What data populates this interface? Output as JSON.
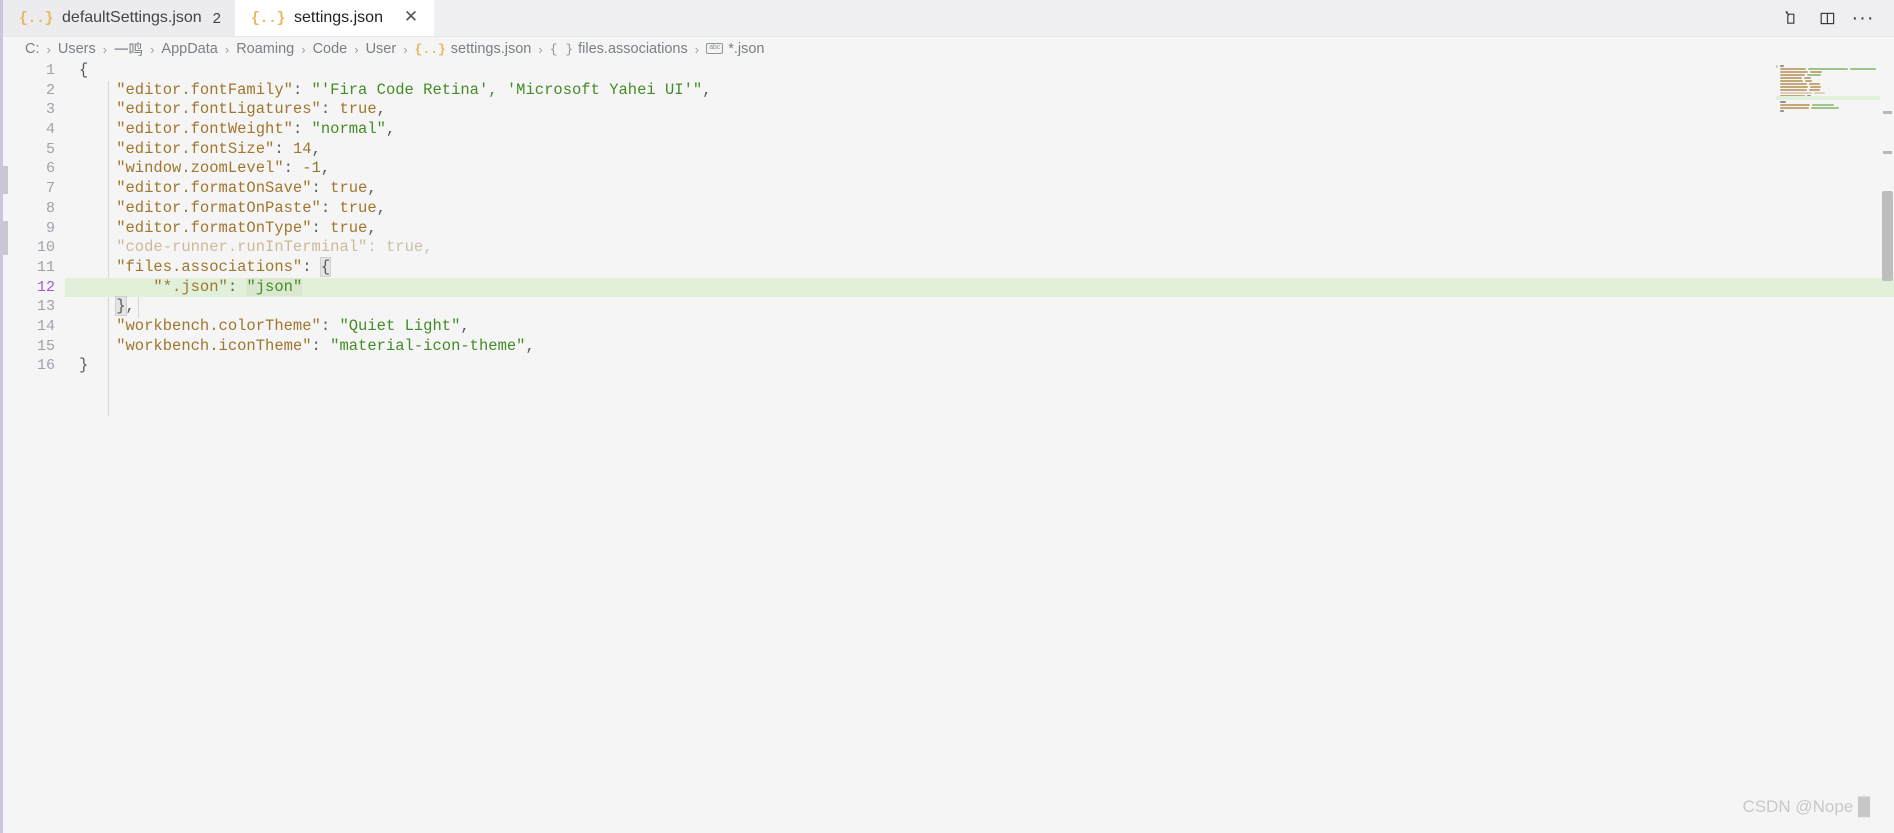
{
  "window": {
    "theme_name": "Quiet Light",
    "accent_color": "#cfc4de",
    "background": "#f5f5f5"
  },
  "tabs": [
    {
      "label": "defaultSettings.json",
      "badge": "2",
      "icon": "json-braces-icon",
      "active": false,
      "closable": false
    },
    {
      "label": "settings.json",
      "badge": "",
      "icon": "json-braces-icon",
      "active": true,
      "closable": true,
      "close_label": "✕"
    }
  ],
  "tabbar_actions": [
    {
      "name": "split-editor-right-button",
      "label": ""
    },
    {
      "name": "toggle-panel-button",
      "label": ""
    },
    {
      "name": "more-actions-button",
      "label": "···"
    }
  ],
  "breadcrumb": {
    "separator": "›",
    "items": [
      {
        "label": "C:",
        "icon": ""
      },
      {
        "label": "Users",
        "icon": ""
      },
      {
        "label": "一鸣",
        "icon": ""
      },
      {
        "label": "AppData",
        "icon": ""
      },
      {
        "label": "Roaming",
        "icon": ""
      },
      {
        "label": "Code",
        "icon": ""
      },
      {
        "label": "User",
        "icon": ""
      },
      {
        "label": "settings.json",
        "icon": "json-file-icon",
        "icon_glyph": "{..}"
      },
      {
        "label": "files.associations",
        "icon": "object-symbol-icon",
        "icon_glyph": "{ }"
      },
      {
        "label": "*.json",
        "icon": "string-symbol-icon",
        "icon_glyph": "abc"
      }
    ]
  },
  "editor": {
    "language": "json",
    "current_line": 12,
    "total_lines": 16,
    "line_numbers": [
      "1",
      "2",
      "3",
      "4",
      "5",
      "6",
      "7",
      "8",
      "9",
      "10",
      "11",
      "12",
      "13",
      "14",
      "15",
      "16"
    ],
    "colors": {
      "key": "#a0762e",
      "string": "#448c27",
      "punctuation": "#555a60",
      "faded_key": "#cdb99a",
      "current_line_bg": "#e1f0d8",
      "current_line_number": "#a05ad4"
    },
    "lines": [
      {
        "n": 1,
        "text": "{"
      },
      {
        "n": 2,
        "text": "    \"editor.fontFamily\": \"'Fira Code Retina', 'Microsoft Yahei UI'\","
      },
      {
        "n": 3,
        "text": "    \"editor.fontLigatures\": true,"
      },
      {
        "n": 4,
        "text": "    \"editor.fontWeight\": \"normal\","
      },
      {
        "n": 5,
        "text": "    \"editor.fontSize\": 14,"
      },
      {
        "n": 6,
        "text": "    \"window.zoomLevel\": -1,"
      },
      {
        "n": 7,
        "text": "    \"editor.formatOnSave\": true,"
      },
      {
        "n": 8,
        "text": "    \"editor.formatOnPaste\": true,"
      },
      {
        "n": 9,
        "text": "    \"editor.formatOnType\": true,"
      },
      {
        "n": 10,
        "text": "    \"code-runner.runInTerminal\": true,"
      },
      {
        "n": 11,
        "text": "    \"files.associations\": {"
      },
      {
        "n": 12,
        "text": "        \"*.json\": \"json\""
      },
      {
        "n": 13,
        "text": "    },"
      },
      {
        "n": 14,
        "text": "    \"workbench.colorTheme\": \"Quiet Light\","
      },
      {
        "n": 15,
        "text": "    \"workbench.iconTheme\": \"material-icon-theme\","
      },
      {
        "n": 16,
        "text": "}"
      }
    ]
  },
  "watermark": {
    "text": "CSDN @Nope █"
  }
}
